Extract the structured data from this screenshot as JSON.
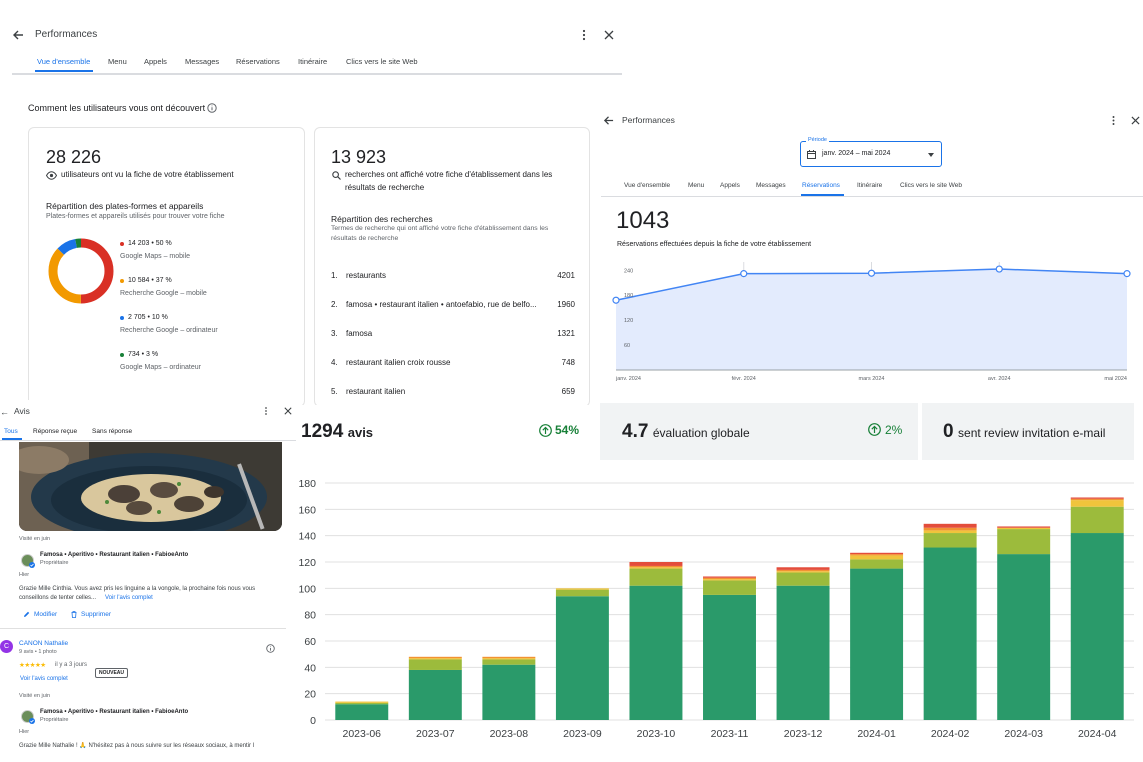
{
  "performances": {
    "title": "Performances",
    "tabs": [
      "Vue d'ensemble",
      "Menu",
      "Appels",
      "Messages",
      "Réservations",
      "Itinéraire",
      "Clics vers le site Web"
    ],
    "section_title": "Comment les utilisateurs vous ont découvert",
    "views": {
      "value": "28 226",
      "label": "utilisateurs ont vu la fiche de votre établissement",
      "breakdown_title": "Répartition des plates-formes et appareils",
      "breakdown_subtitle": "Plates-formes et appareils utilisés pour trouver votre fiche",
      "platforms": [
        {
          "stat": "14 203 • 50 %",
          "name": "Google Maps – mobile",
          "color": "#d93025",
          "pct": 50
        },
        {
          "stat": "10 584 • 37 %",
          "name": "Recherche Google – mobile",
          "color": "#f29900",
          "pct": 37
        },
        {
          "stat": "2 705 • 10 %",
          "name": "Recherche Google – ordinateur",
          "color": "#1a73e8",
          "pct": 10
        },
        {
          "stat": "734 • 3 %",
          "name": "Google Maps – ordinateur",
          "color": "#188038",
          "pct": 3
        }
      ]
    },
    "searches": {
      "value": "13 923",
      "label_line1": "recherches ont affiché votre fiche d'établissement dans les",
      "label_line2": "résultats de recherche",
      "breakdown_title": "Répartition des recherches",
      "breakdown_subtitle_line1": "Termes de recherche qui ont affiché votre fiche d'établissement dans les",
      "breakdown_subtitle_line2": "résultats de recherche",
      "terms": [
        {
          "rank": "1.",
          "term": "restaurants",
          "count": "4201"
        },
        {
          "rank": "2.",
          "term": "famosa • restaurant italien • antoefabio, rue de belfo...",
          "count": "1960"
        },
        {
          "rank": "3.",
          "term": "famosa",
          "count": "1321"
        },
        {
          "rank": "4.",
          "term": "restaurant italien croix rousse",
          "count": "748"
        },
        {
          "rank": "5.",
          "term": "restaurant italien",
          "count": "659"
        }
      ]
    }
  },
  "reservations": {
    "title": "Performances",
    "period_label": "Période",
    "period_value": "janv. 2024 – mai 2024",
    "tabs": [
      "Vue d'ensemble",
      "Menu",
      "Appels",
      "Messages",
      "Réservations",
      "Itinéraire",
      "Clics vers le site Web"
    ],
    "active_tab": "Réservations",
    "value": "1043",
    "label": "Réservations effectuées depuis la fiche de votre établissement",
    "chart_data": {
      "type": "area",
      "x": [
        "janv. 2024",
        "févr. 2024",
        "mars 2024",
        "avr. 2024",
        "mai 2024"
      ],
      "values": [
        168,
        232,
        233,
        243,
        232
      ],
      "y_ticks": [
        240,
        180,
        120,
        60
      ],
      "ylim": [
        0,
        260
      ],
      "color": "#4285f4"
    }
  },
  "reviews_panel": {
    "title": "Avis",
    "tabs": [
      "Tous",
      "Réponse reçue",
      "Sans réponse"
    ],
    "visited1": "Visité en juin",
    "owner_name": "Famosa • Aperitivo • Restaurant italien • FabioeAnto",
    "owner_role": "Propriétaire",
    "reply_time": "Hier",
    "reply_text_1": "Grazie Mille Cinthia. Vous avez pris les linguine a la vongole, la prochaine fois nous vous",
    "reply_text_2": "conseillons de tenter celles...",
    "see_full": "Voir l'avis complet",
    "edit": "Modifier",
    "delete": "Supprimer",
    "reviewer_initial": "C",
    "reviewer_name": "CANON Nathalie",
    "reviewer_meta": "9 avis • 1 photo",
    "stars": "★★★★★",
    "time_ago": "il y a 3 jours",
    "new_badge": "NOUVEAU",
    "see_full2": "Voir l'avis complet",
    "visited2": "Visité en juin",
    "owner_name2": "Famosa • Aperitivo • Restaurant italien • FabioeAnto",
    "owner_role2": "Propriétaire",
    "reply_time2": "Hier",
    "reply_text2": "Grazie Mille Nathalie ! 🙏 N'hésitez pas à nous suivre sur les réseaux sociaux, à mentir l"
  },
  "stats": {
    "reviews_count": "1294",
    "reviews_label": "avis",
    "reviews_growth": "54%",
    "rating": "4.7",
    "rating_label": "évaluation globale",
    "rating_growth": "2%",
    "invites": "0",
    "invites_label": "sent review invitation e-mail",
    "growth_color": "#188038"
  },
  "chart_data": {
    "type": "bar",
    "stacked": true,
    "categories": [
      "2023-06",
      "2023-07",
      "2023-08",
      "2023-09",
      "2023-10",
      "2023-11",
      "2023-12",
      "2024-01",
      "2024-02",
      "2024-03",
      "2024-04"
    ],
    "y_ticks": [
      0,
      20,
      40,
      60,
      80,
      100,
      120,
      140,
      160,
      180
    ],
    "ylim": [
      0,
      180
    ],
    "series": [
      {
        "color": "#2a9a6a",
        "values": [
          12,
          38,
          42,
          94,
          102,
          95,
          102,
          115,
          131,
          126,
          142
        ]
      },
      {
        "color": "#9cbb3c",
        "values": [
          1,
          8,
          4,
          5,
          13,
          11,
          10,
          7,
          11,
          19,
          20
        ]
      },
      {
        "color": "#f0c43c",
        "values": [
          1,
          1,
          1,
          1,
          1,
          1,
          1,
          3,
          2,
          1,
          5
        ]
      },
      {
        "color": "#f29233",
        "values": [
          0,
          1,
          1,
          0,
          1,
          1,
          1,
          1,
          2,
          0,
          1
        ]
      },
      {
        "color": "#e34d3b",
        "values": [
          0,
          0,
          0,
          0,
          3,
          1,
          2,
          1,
          3,
          1,
          1
        ]
      }
    ]
  }
}
